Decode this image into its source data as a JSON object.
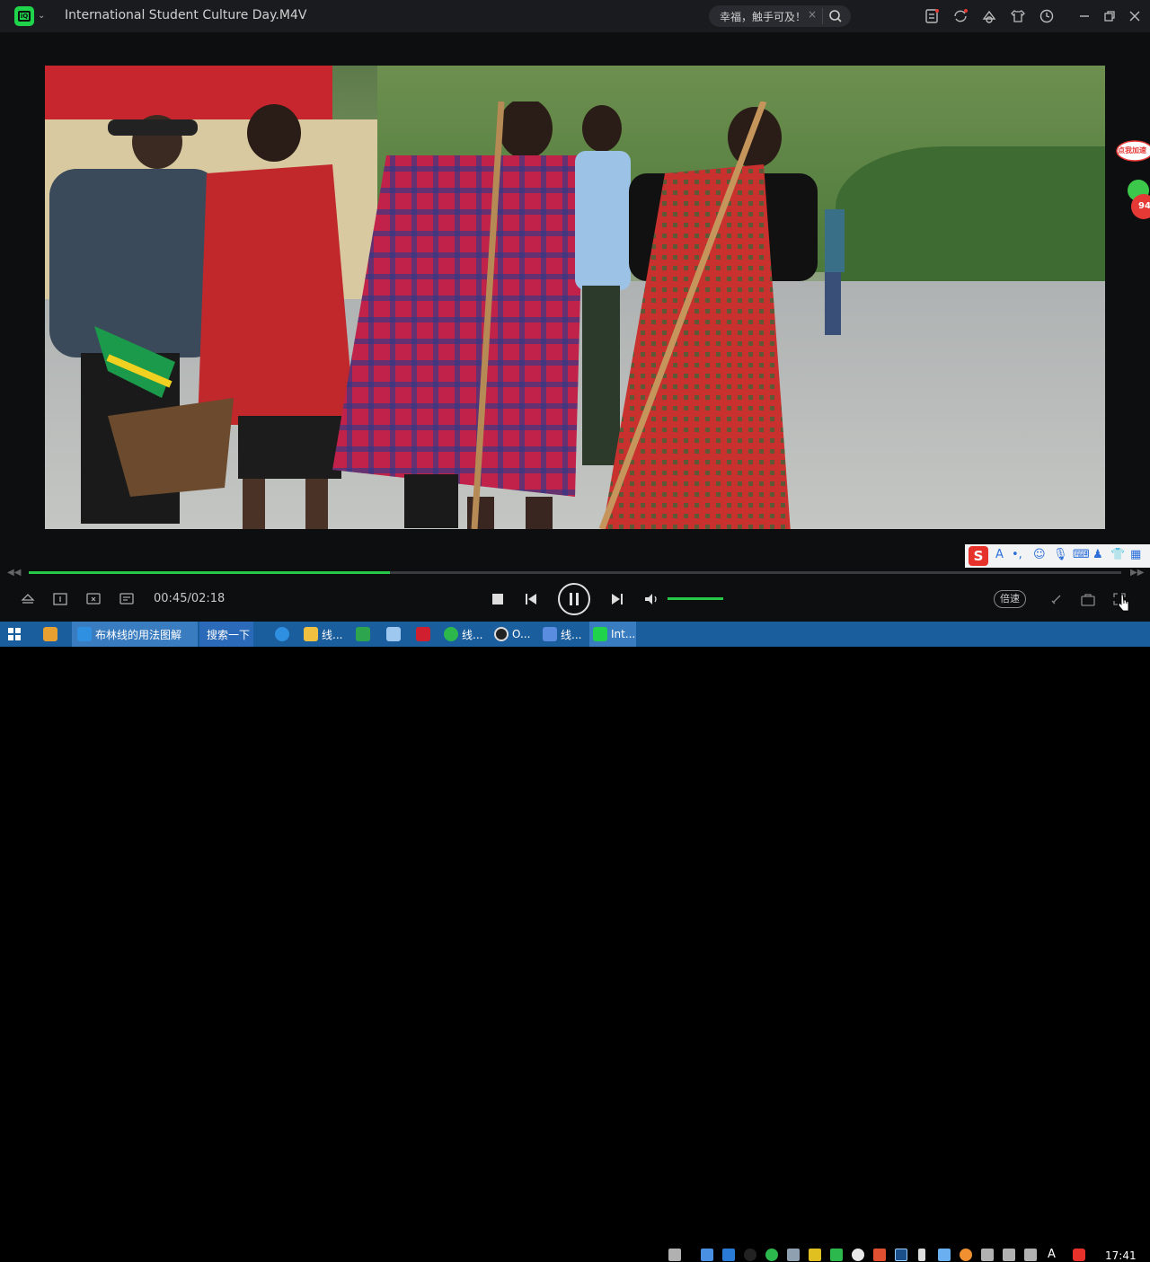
{
  "window": {
    "title": "International Student Culture Day.M4V",
    "search_text": "幸福，触手可及！",
    "search_clear": "×"
  },
  "player": {
    "time": "00:45/02:18",
    "progress": 0.331,
    "volume": 0.8,
    "speed_label": "倍速",
    "skip_back": "◀◀",
    "skip_forward": "▶▶"
  },
  "float_widget": {
    "badge_text": "点我加速",
    "count": "94"
  },
  "ime": {
    "logo": "S",
    "mode": "A",
    "punct": "•,"
  },
  "taskbar": {
    "apps": [
      {
        "label": "布林线的用法图解",
        "icon": "ie-icon"
      },
      {
        "label": "搜索一下",
        "icon": ""
      },
      {
        "label": "线...",
        "icon": "folder-icon"
      },
      {
        "label": "线...",
        "icon": "wechat-icon"
      },
      {
        "label": "O...",
        "icon": "obs-icon"
      },
      {
        "label": "线...",
        "icon": "paint-icon"
      },
      {
        "label": "Int...",
        "icon": "iqiyi-icon"
      }
    ],
    "clock": "17:41"
  },
  "colors": {
    "accent": "#25c847",
    "taskbar": "#1b5e9e",
    "titlebar": "#1a1b1f"
  }
}
